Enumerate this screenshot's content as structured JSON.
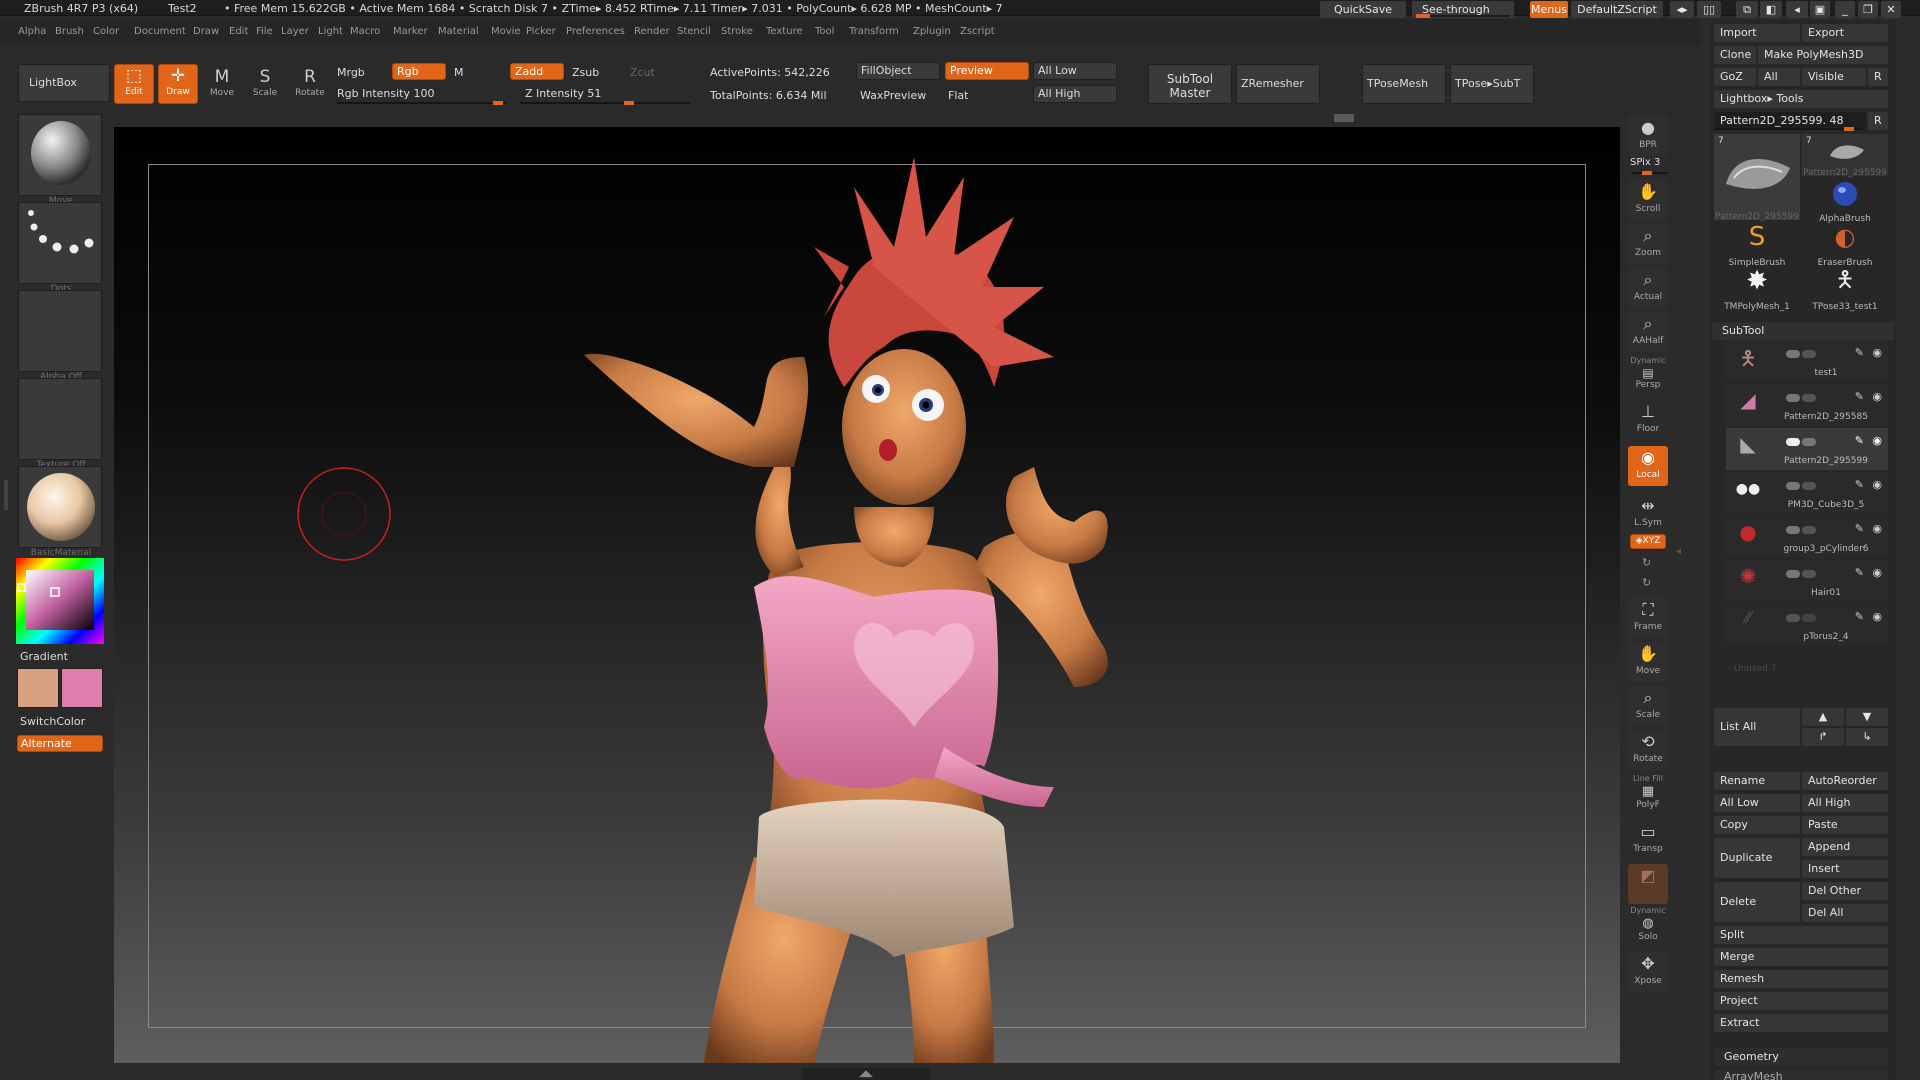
{
  "titlebar": {
    "app": "ZBrush 4R7 P3 (x64)",
    "doc": "Test2",
    "stats": "• Free Mem 15.622GB • Active Mem 1684 • Scratch Disk 7 •  ZTime▸ 8.452 RTime▸ 7.11  Timer▸ 7.031 • PolyCount▸ 6.628  MP • MeshCount▸ 7",
    "quicksave": "QuickSave",
    "see_through": "See-through",
    "see_through_value": "0",
    "menus": "Menus",
    "script": "DefaultZScript"
  },
  "menubar": [
    "Alpha",
    "Brush",
    "Color",
    "Document",
    "Draw",
    "Edit",
    "File",
    "Layer",
    "Light",
    "Macro",
    "Marker",
    "Material",
    "Movie",
    "Picker",
    "Preferences",
    "Render",
    "Stencil",
    "Stroke",
    "Texture",
    "Tool",
    "Transform",
    "Zplugin",
    "Zscript"
  ],
  "shelf": {
    "lightbox": "LightBox",
    "edit": "Edit",
    "draw": "Draw",
    "move": "Move",
    "scale": "Scale",
    "rotate": "Rotate",
    "mrgb": "Mrgb",
    "rgb": "Rgb",
    "m": "M",
    "rgb_intensity": "Rgb Intensity 100",
    "zadd": "Zadd",
    "zsub": "Zsub",
    "zcut": "Zcut",
    "z_intensity": "Z Intensity 51",
    "active_points": "ActivePoints: 542,226",
    "total_points": "TotalPoints: 6.634 Mil",
    "fill_object": "FillObject",
    "preview": "Preview",
    "wax_preview": "WaxPreview",
    "flat": "Flat",
    "all_low": "All Low",
    "all_high": "All High",
    "subtool_master_1": "SubTool",
    "subtool_master_2": "Master",
    "zremesher": "ZRemesher",
    "tpose_mesh": "TPoseMesh",
    "tpose_subt": "TPose▸SubT"
  },
  "lefttray": {
    "brush_cap": "Move",
    "stroke_cap": "Dots",
    "alpha_cap": "Alpha Off",
    "texture_cap": "Texture Off",
    "material_cap": "BasicMaterial",
    "gradient": "Gradient",
    "switch_color": "SwitchColor",
    "alternate": "Alternate",
    "colors": {
      "main": "#d9a181",
      "secondary": "#de7fad"
    }
  },
  "righttools": {
    "bpr": "BPR",
    "spix": "SPix 3",
    "scroll": "Scroll",
    "zoom": "Zoom",
    "actual": "Actual",
    "aahalf": "AAHalf",
    "dynamic": "Dynamic",
    "persp": "Persp",
    "floor": "Floor",
    "local": "Local",
    "lsym": "L.Sym",
    "xyz": "◈XYZ",
    "frame": "Frame",
    "move": "Move",
    "scale": "Scale",
    "rotate": "Rotate",
    "linefill": "Line Fill",
    "polyf": "PolyF",
    "transp": "Transp",
    "dynamic2": "Dynamic",
    "solo": "Solo",
    "xpose": "Xpose"
  },
  "rpanel": {
    "import": "Import",
    "export": "Export",
    "clone": "Clone",
    "make_polymesh": "Make PolyMesh3D",
    "goz": "GoZ",
    "all": "All",
    "visible": "Visible",
    "r": "R",
    "lightbox_tools": "Lightbox▸ Tools",
    "current_tool": "Pattern2D_295599. 48",
    "tools": [
      {
        "name": "Pattern2D_295599",
        "count": "7"
      },
      {
        "name": "Pattern2D_295599",
        "count": "7"
      },
      {
        "name": "AlphaBrush"
      },
      {
        "name": "SimpleBrush"
      },
      {
        "name": "EraserBrush"
      },
      {
        "name": "TMPolyMesh_1"
      },
      {
        "name": "TPose33_test1"
      }
    ],
    "subtool": "SubTool",
    "subtools": [
      "test1",
      "Pattern2D_295585",
      "Pattern2D_295599",
      "PM3D_Cube3D_5",
      "group3_pCylinder6",
      "Hair01",
      "pTorus2_4"
    ],
    "unused": "Unused 7",
    "list_all": "List All",
    "rename": "Rename",
    "autoreorder": "AutoReorder",
    "all_low": "All Low",
    "all_high": "All High",
    "copy": "Copy",
    "paste": "Paste",
    "duplicate": "Duplicate",
    "append": "Append",
    "insert": "Insert",
    "delete": "Delete",
    "del_other": "Del Other",
    "del_all": "Del All",
    "split": "Split",
    "merge": "Merge",
    "remesh": "Remesh",
    "project": "Project",
    "extract": "Extract",
    "geometry": "Geometry",
    "array_mesh": "ArrayMesh"
  },
  "accent": "#e2661a"
}
